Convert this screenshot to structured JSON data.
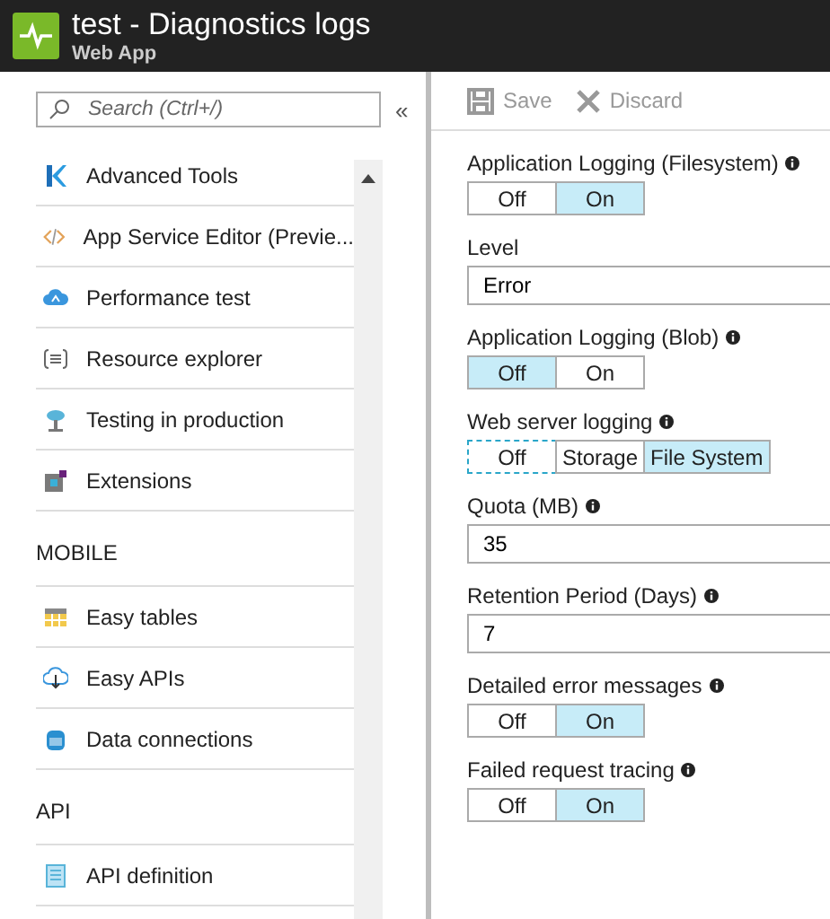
{
  "header": {
    "title": "test - Diagnostics logs",
    "subtitle": "Web App"
  },
  "search": {
    "placeholder": "Search (Ctrl+/)",
    "collapse": "«"
  },
  "sidebar": [
    {
      "kind": "item",
      "label": "Advanced Tools"
    },
    {
      "kind": "item",
      "label": "App Service Editor (Previe..."
    },
    {
      "kind": "item",
      "label": "Performance test"
    },
    {
      "kind": "item",
      "label": "Resource explorer"
    },
    {
      "kind": "item",
      "label": "Testing in production"
    },
    {
      "kind": "item",
      "label": "Extensions"
    },
    {
      "kind": "heading",
      "label": "MOBILE"
    },
    {
      "kind": "item",
      "label": "Easy tables"
    },
    {
      "kind": "item",
      "label": "Easy APIs"
    },
    {
      "kind": "item",
      "label": "Data connections"
    },
    {
      "kind": "heading",
      "label": "API"
    },
    {
      "kind": "item",
      "label": "API definition"
    }
  ],
  "toolbar": [
    {
      "kind": "save",
      "label": "Save",
      "disabled": true
    },
    {
      "kind": "discard",
      "label": "Discard",
      "disabled": true
    }
  ],
  "fields": [
    {
      "kind": "toggle",
      "label": "Application Logging (Filesystem)",
      "info": true,
      "options": [
        {
          "label": "Off",
          "selected": false
        },
        {
          "label": "On",
          "selected": true
        }
      ]
    },
    {
      "kind": "input",
      "label": "Level",
      "info": false,
      "value": "Error"
    },
    {
      "kind": "toggle",
      "label": "Application Logging (Blob)",
      "info": true,
      "options": [
        {
          "label": "Off",
          "selected": true
        },
        {
          "label": "On",
          "selected": false
        }
      ]
    },
    {
      "kind": "toggle",
      "label": "Web server logging",
      "info": true,
      "options": [
        {
          "label": "Off",
          "selected": false,
          "focused": true
        },
        {
          "label": "Storage",
          "selected": false,
          "focused": false
        },
        {
          "label": "File System",
          "selected": true,
          "focused": false
        }
      ]
    },
    {
      "kind": "input",
      "label": "Quota (MB)",
      "info": true,
      "value": "35"
    },
    {
      "kind": "input",
      "label": "Retention Period (Days)",
      "info": true,
      "value": "7"
    },
    {
      "kind": "toggle",
      "label": "Detailed error messages",
      "info": true,
      "options": [
        {
          "label": "Off",
          "selected": false
        },
        {
          "label": "On",
          "selected": true
        }
      ]
    },
    {
      "kind": "toggle",
      "label": "Failed request tracing",
      "info": true,
      "options": [
        {
          "label": "Off",
          "selected": false
        },
        {
          "label": "On",
          "selected": true
        }
      ]
    }
  ]
}
